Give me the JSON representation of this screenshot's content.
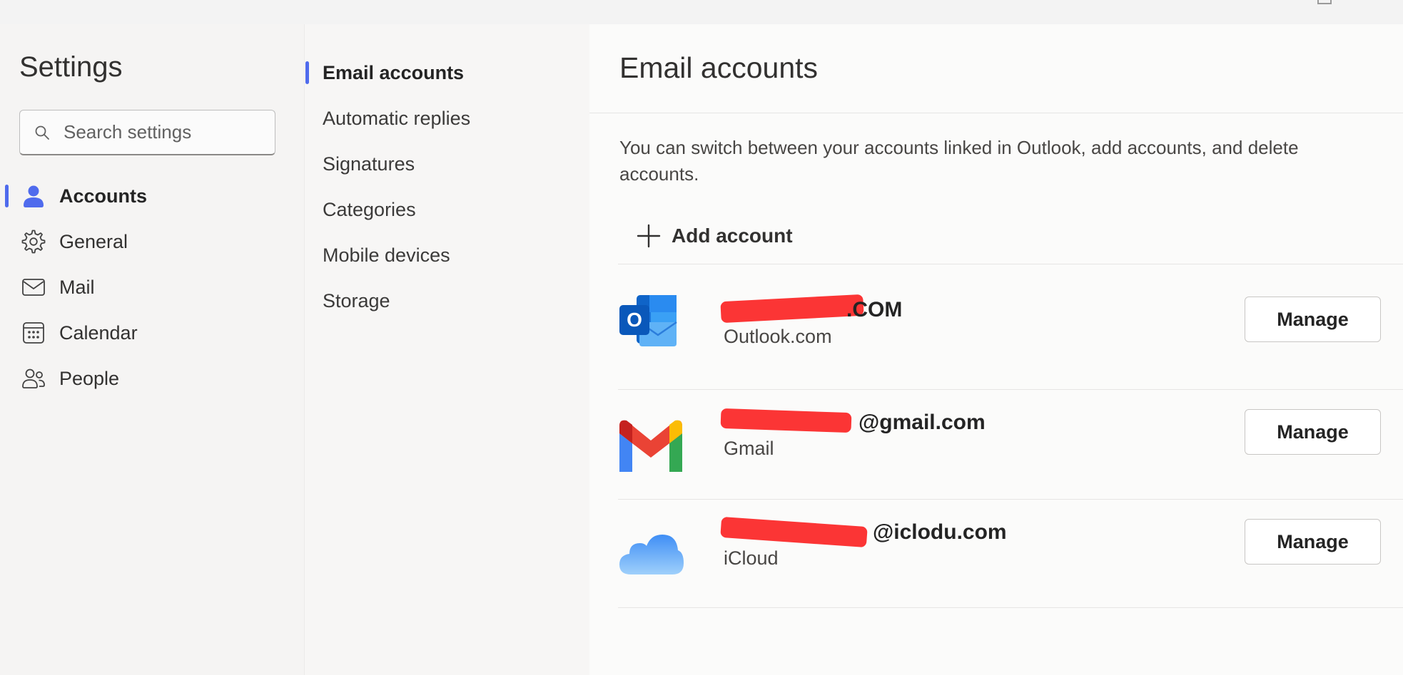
{
  "settings": {
    "title": "Settings",
    "search_placeholder": "Search settings"
  },
  "nav": {
    "items": [
      {
        "label": "Accounts",
        "icon": "person-icon",
        "active": true
      },
      {
        "label": "General",
        "icon": "gear-icon",
        "active": false
      },
      {
        "label": "Mail",
        "icon": "envelope-icon",
        "active": false
      },
      {
        "label": "Calendar",
        "icon": "calendar-icon",
        "active": false
      },
      {
        "label": "People",
        "icon": "people-icon",
        "active": false
      }
    ]
  },
  "subnav": {
    "items": [
      {
        "label": "Email accounts",
        "active": true
      },
      {
        "label": "Automatic replies",
        "active": false
      },
      {
        "label": "Signatures",
        "active": false
      },
      {
        "label": "Categories",
        "active": false
      },
      {
        "label": "Mobile devices",
        "active": false
      },
      {
        "label": "Storage",
        "active": false
      }
    ]
  },
  "content": {
    "title": "Email accounts",
    "description": "You can switch between your accounts linked in Outlook, add accounts, and delete accounts.",
    "add_account_label": "Add account",
    "accounts": [
      {
        "email_visible": ".COM",
        "provider": "Outlook.com",
        "icon": "outlook-logo-icon",
        "manage_label": "Manage"
      },
      {
        "email_visible": "@gmail.com",
        "provider": "Gmail",
        "icon": "gmail-logo-icon",
        "manage_label": "Manage"
      },
      {
        "email_visible": "@iclodu.com",
        "provider": "iCloud",
        "icon": "icloud-logo-icon",
        "manage_label": "Manage"
      }
    ]
  },
  "colors": {
    "accent": "#4f6bed",
    "redaction": "#fb3535"
  }
}
